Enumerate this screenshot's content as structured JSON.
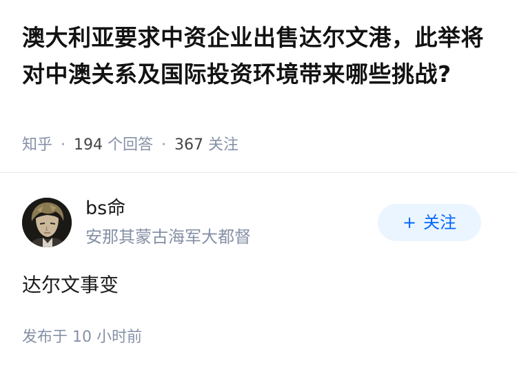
{
  "question": {
    "title": "澳大利亚要求中资企业出售达尔文港，此举将对中澳关系及国际投资环境带来哪些挑战?",
    "source": "知乎",
    "answers_count": "194",
    "answers_label": "个回答",
    "follow_count": "367",
    "follow_label": "关注"
  },
  "answer": {
    "author": {
      "name": "bs命",
      "bio": "安那其蒙古海军大都督",
      "avatar_icon": "avatar-anime-character"
    },
    "follow_button": {
      "plus": "+",
      "label": "关注"
    },
    "content": "达尔文事变",
    "published": {
      "prefix": "发布于",
      "time": "10 小时前"
    }
  },
  "colors": {
    "meta_gray": "#8590a6",
    "follow_bg": "#ebf5ff",
    "follow_text": "#0066ff",
    "divider": "#ebebeb"
  }
}
